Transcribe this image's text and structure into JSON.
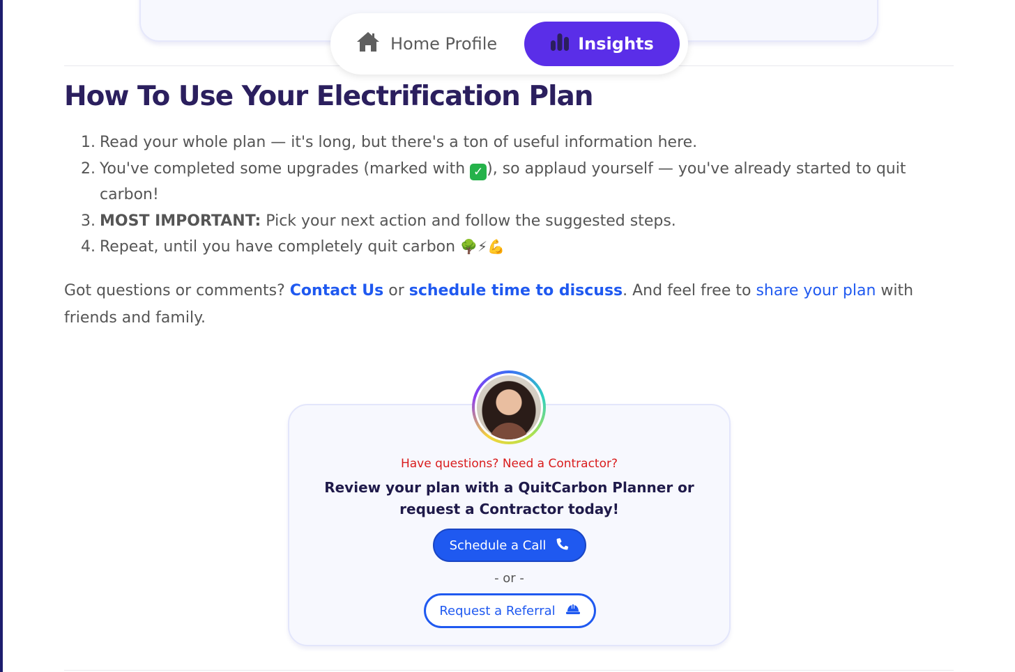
{
  "tabs": {
    "home_label": "Home Profile",
    "insights_label": "Insights",
    "active_color": "#5a2ee8"
  },
  "heading": "How To Use Your Electrification Plan",
  "steps": [
    {
      "num": "1.",
      "text": "Read your whole plan — it's long, but there's a ton of useful information here."
    },
    {
      "num": "2.",
      "text_before": "You've completed some upgrades (marked with ",
      "check": "✓",
      "text_after": "), so applaud yourself — you've already started to quit carbon!"
    },
    {
      "num": "3.",
      "strong": "MOST IMPORTANT:",
      "text": " Pick your next action and follow the suggested steps."
    },
    {
      "num": "4.",
      "text": "Repeat, until you have completely quit carbon ",
      "emojis": "🌳⚡💪"
    }
  ],
  "intro": {
    "part1": "Got questions or comments? ",
    "contact_link": "Contact Us",
    "part2": " or ",
    "schedule_link": "schedule time to discuss",
    "part3": ". And feel free to ",
    "share_link": "share your plan",
    "part4": " with friends and family.",
    "link_color": "#1f59f0"
  },
  "cta": {
    "eyebrow": "Have questions? Need a Contractor?",
    "headline": "Review your plan with a QuitCarbon Planner or request a Contractor today!",
    "schedule_button": "Schedule a Call",
    "or_text": "- or -",
    "referral_button": "Request a Referral",
    "eyebrow_color": "#d91c1c"
  },
  "icons": {
    "home": "home-icon",
    "insights": "bar-chart-icon",
    "phone": "phone-icon",
    "hardhat": "hard-hat-icon"
  }
}
